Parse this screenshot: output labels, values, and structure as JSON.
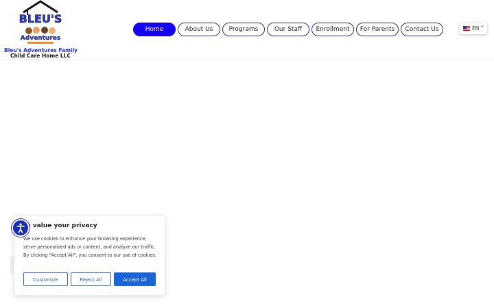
{
  "header": {
    "logo": {
      "wordmark": "BLEU'S Adventures",
      "name_line1": "Bleu's Adventures Family",
      "name_line2": "Child Care Home LLC"
    },
    "nav": [
      {
        "label": "Home",
        "active": true
      },
      {
        "label": "About Us",
        "active": false
      },
      {
        "label": "Programs",
        "active": false
      },
      {
        "label": "Our Staff",
        "active": false
      },
      {
        "label": "Enrollment",
        "active": false
      },
      {
        "label": "For Parents",
        "active": false
      },
      {
        "label": "Contact Us",
        "active": false
      }
    ],
    "language": {
      "code": "EN",
      "flag": "us-flag-icon",
      "chevron": "chevron-up-icon"
    }
  },
  "cookie_banner": {
    "title": "We value your privacy",
    "body": "We use cookies to enhance your browsing experience, serve personalized ads or content, and analyze our traffic. By clicking \"Accept All\", you consent to our use of cookies.",
    "buttons": {
      "customize": "Customize",
      "reject": "Reject All",
      "accept": "Accept All"
    }
  },
  "accessibility": {
    "icon": "accessibility-icon"
  },
  "colors": {
    "nav_active": "#1500f0",
    "brand_blue": "#1e2fd0",
    "accept_button": "#1a64d8"
  }
}
